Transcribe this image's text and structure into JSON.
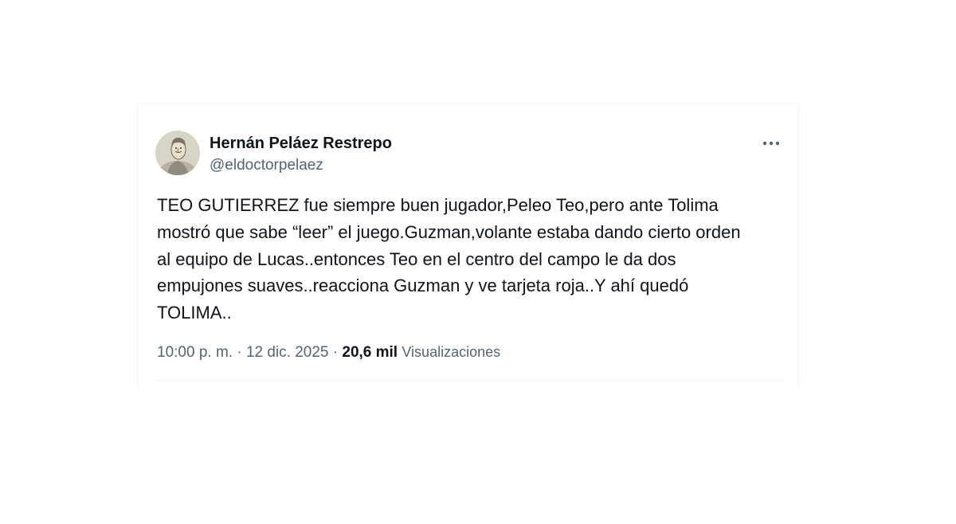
{
  "tweet": {
    "author": {
      "name": "Hernán Peláez Restrepo",
      "handle": "@eldoctorpelaez",
      "avatar_icon": "caricature-avatar"
    },
    "more_icon": "ellipsis-icon",
    "text_lines": [
      "TEO GUTIERREZ fue siempre buen jugador,Peleo Teo,pero ante Tolima",
      "mostró que sabe “leer” el juego.Guzman,volante estaba dando cierto orden",
      "al equipo de Lucas..entonces Teo en el centro del campo le da dos",
      "empujones suaves..reacciona Guzman y ve tarjeta roja..Y ahí quedó",
      "TOLIMA.."
    ],
    "meta": {
      "time": "10:00 p. m.",
      "separator": " · ",
      "date": "12 dic. 2025",
      "views_count": "20,6 mil",
      "views_label": "Visualizaciones"
    }
  },
  "colors": {
    "text_primary": "#0f1419",
    "text_secondary": "#536471",
    "border": "#eff3f4"
  }
}
